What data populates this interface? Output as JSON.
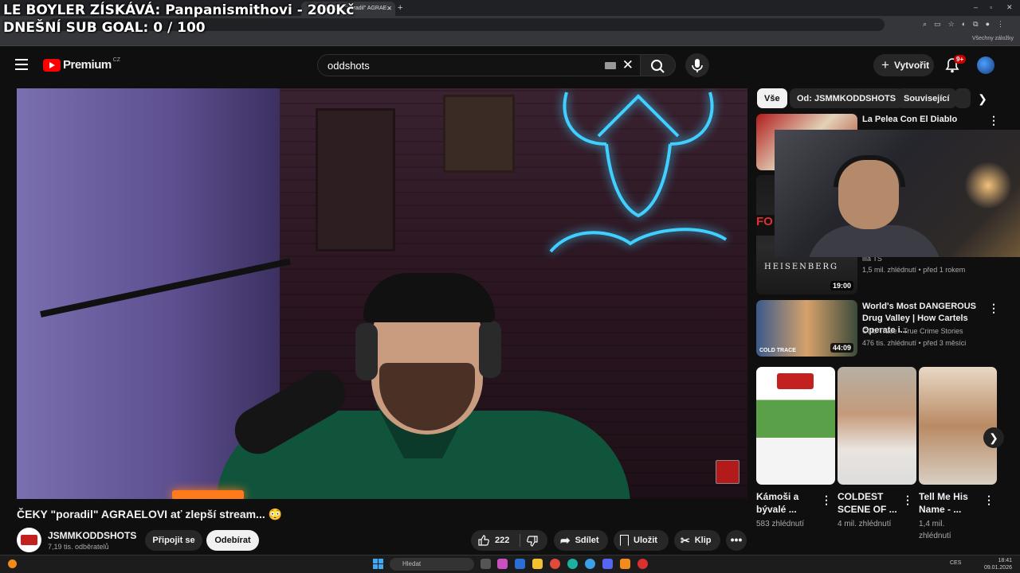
{
  "stream_overlay": {
    "line1": "LE BOYLER ZÍSKÁVÁ: Panpanismithovi - 200Kč",
    "line2": "DNEŠNÍ SUB GOAL: 0 / 100"
  },
  "browser": {
    "active_tab_title": "(13) ČEKY \"poradil\" AGRAE...",
    "bookmarks_all": "Všechny záložky"
  },
  "header": {
    "brand": "Premium",
    "country": "CZ",
    "search_value": "oddshots",
    "create_label": "Vytvořit",
    "notification_count": "9+"
  },
  "video": {
    "title": "ČEKY \"poradil\" AGRAELOVI ať zlepší stream... 😳",
    "channel_name": "JSMMKODDSHOTS",
    "channel_subs": "7,19 tis. odběratelů",
    "join_label": "Připojit se",
    "subscribe_label": "Odebírat",
    "likes": "222",
    "share_label": "Sdílet",
    "save_label": "Uložit",
    "clip_label": "Klip",
    "more_label": "•••"
  },
  "chips": [
    {
      "label": "Vše",
      "active": true
    },
    {
      "label": "Od: JSMMKODDSHOTS",
      "active": false
    },
    {
      "label": "Související",
      "active": false
    }
  ],
  "recommendations": [
    {
      "title": "La Pelea Con El Diablo",
      "meta1": "",
      "meta2": ""
    },
    {
      "title": "",
      "channel": "illa TS",
      "meta2": "1,5 mil. zhlédnutí • před 1 rokem",
      "duration": "19:00"
    },
    {
      "title": "World's Most DANGEROUS Drug Valley | How Cartels Operate i...",
      "channel": "Cold Trace - True Crime Stories",
      "meta2": "476 tis. zhlédnutí • před 3 měsíci",
      "duration": "44:09"
    }
  ],
  "shorts": [
    {
      "title": "Kámoši a bývalé ...",
      "views": "583 zhlédnutí"
    },
    {
      "title": "COLDEST SCENE OF ...",
      "views": "4 mil. zhlédnutí"
    },
    {
      "title": "Tell Me His Name - ...",
      "views": "1,4 mil. zhlédnutí"
    }
  ],
  "thumb_text": {
    "heisenberg": "HEISENBERG",
    "cold_trace": "COLD TRACE"
  },
  "taskbar": {
    "search_placeholder": "Hledat",
    "lang": "CES",
    "time": "18:41",
    "date": "09.01.2026"
  },
  "colors": {
    "accent_red": "#ff0000",
    "background": "#0f0f0f",
    "chip_bg": "#272727"
  }
}
